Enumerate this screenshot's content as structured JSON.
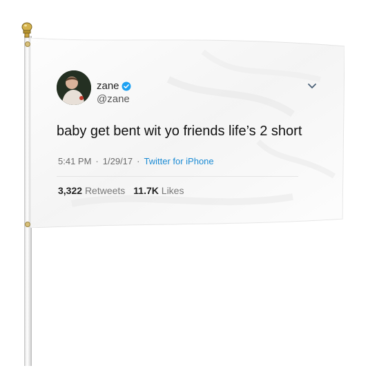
{
  "tweet": {
    "display_name": "zane",
    "handle": "@zane",
    "text": "baby get bent wit yo friends life’s 2 short",
    "time": "5:41 PM",
    "date": "1/29/17",
    "separator": "·",
    "source": "Twitter for iPhone",
    "retweets_count": "3,322",
    "retweets_label": "Retweets",
    "likes_count": "11.7K",
    "likes_label": "Likes"
  },
  "icons": {
    "verified": "verified-badge-icon",
    "menu": "chevron-down-icon",
    "finial": "pole-finial-icon"
  },
  "colors": {
    "link": "#1b8bd4",
    "verified": "#1da1f2",
    "finial": "#d4b24c"
  }
}
